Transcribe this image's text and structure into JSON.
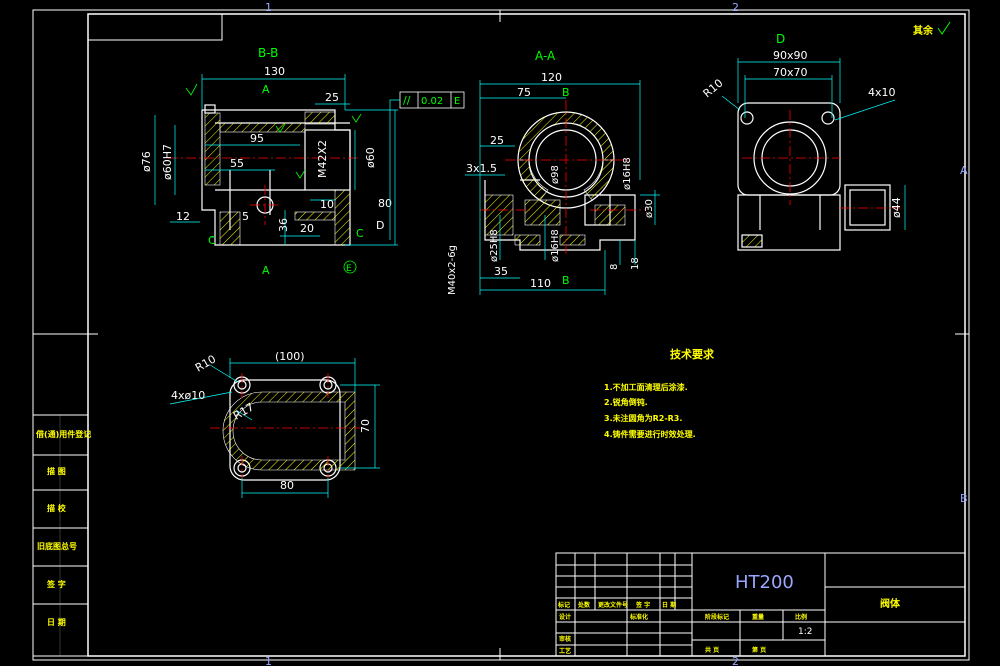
{
  "colors": {
    "background": "#000000",
    "frame": "#ffffff",
    "outline": "#ffffff",
    "dimension": "#00ffff",
    "text_green": "#00ff00",
    "center_line": "#ff0000",
    "hatch": "#ffff00",
    "title_text": "#ffff00",
    "material": "#9aa6ff"
  },
  "border": {
    "top_zones": [
      "1",
      "2"
    ],
    "bottom_zones": [
      "1",
      "2"
    ],
    "right_zones": [
      "A",
      "B"
    ]
  },
  "roughness_note": "其余",
  "views": {
    "bb": {
      "title": "B-B",
      "dims": {
        "d130": "130",
        "d25": "25",
        "d95": "95",
        "d55": "55",
        "d76": "ø76",
        "d60h7": "ø60H7",
        "m42": "M42X2",
        "d60": "ø60",
        "d12": "12",
        "d5": "5",
        "d36": "36",
        "d20": "20",
        "d10": "10",
        "d80": "80"
      },
      "section_a_top": "A",
      "section_a_bottom": "A",
      "section_c_left": "C",
      "section_c_right": "C",
      "datum_d": "D",
      "datum_e": "E"
    },
    "aa": {
      "title": "A-A",
      "dims": {
        "d120": "120",
        "d75": "75",
        "d25": "25",
        "d3x15": "3x1.5",
        "d16h8a": "ø16H8",
        "d30": "ø30",
        "d25h8": "ø25H8",
        "d16h8b": "ø16H8",
        "m40": "M40x2-6g",
        "d35": "35",
        "d110": "110",
        "d8": "8",
        "d18": "18",
        "d98": "ø98"
      },
      "section_b_top": "B",
      "section_b_bottom": "B"
    },
    "d": {
      "title": "D",
      "dims": {
        "d90x90": "90x90",
        "d70x70": "70x70",
        "r10": "R10",
        "holes": "4x10",
        "d44": "ø44"
      }
    },
    "c": {
      "dims": {
        "d100": "(100)",
        "r10": "R10",
        "r17": "R17",
        "holes": "4xø10",
        "d70": "70",
        "d80": "80"
      }
    }
  },
  "tolerance_frame": {
    "symbol": "//",
    "value": "0.02",
    "datum": "E"
  },
  "tech_requirements": {
    "title": "技术要求",
    "items": [
      "1.不加工面清理后涂漆.",
      "2.锐角倒钝.",
      "3.未注圆角为R2-R3.",
      "4.铸件需要进行时效处理."
    ]
  },
  "side_labels": [
    "借(通)用件登记",
    "描 图",
    "描 校",
    "旧底图总号",
    "签 字",
    "日 期"
  ],
  "title_block": {
    "material": "HT200",
    "part_name": "阀体",
    "scale": "1:2",
    "row_labels": [
      "标记",
      "处数",
      "更改文件号",
      "签 字",
      "日 期"
    ],
    "labels_design": "设计",
    "labels_check": "审核",
    "labels_process": "工艺",
    "labels_std": "标准化",
    "labels_stage": "阶段标记",
    "labels_weight": "重量",
    "labels_scale": "比例",
    "labels_sheet_total": "共 页",
    "labels_sheet": "第 页"
  }
}
